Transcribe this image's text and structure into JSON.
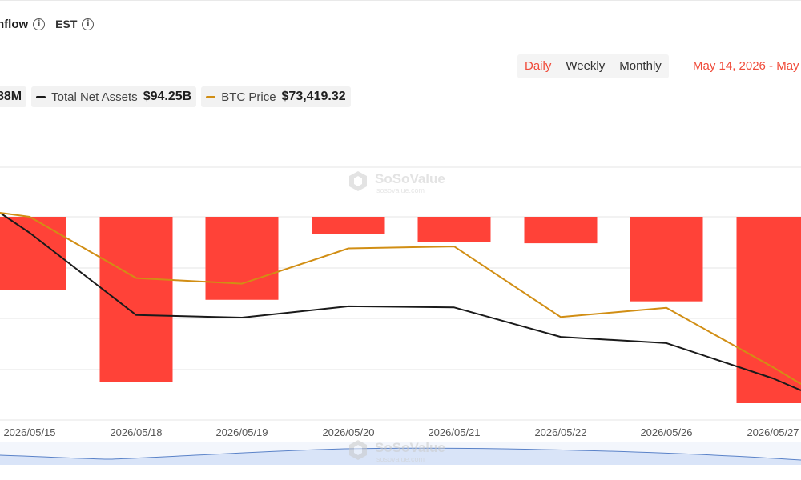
{
  "header": {
    "title": "nflow",
    "timezone": "EST"
  },
  "controls": {
    "periods": [
      {
        "label": "Daily",
        "active": true
      },
      {
        "label": "Weekly",
        "active": false
      },
      {
        "label": "Monthly",
        "active": false
      }
    ],
    "date_range": "May 14, 2026 - May"
  },
  "legend": {
    "inflow_value": "88M",
    "assets_label": "Total Net Assets",
    "assets_value": "$94.25B",
    "btc_label": "BTC Price",
    "btc_value": "$73,419.32"
  },
  "watermark": {
    "brand": "SoSoValue",
    "domain": "sosovalue.com"
  },
  "colors": {
    "inflow_bar": "#ff4238",
    "net_assets_line": "#1a1a1a",
    "btc_line": "#d18e14",
    "accent": "#f04b3a",
    "navigator_fill": "#d9e4f8",
    "navigator_line": "#5a82c8"
  },
  "chart_data": {
    "type": "bar",
    "categories": [
      "2026/05/15",
      "2026/05/18",
      "2026/05/19",
      "2026/05/20",
      "2026/05/21",
      "2026/05/22",
      "2026/05/26",
      "2026/05/27"
    ],
    "series": [
      {
        "values": [
          -144,
          -324,
          -163,
          -34,
          -49,
          -52,
          -166,
          -366
        ]
      },
      {
        "values": [
          97.05,
          94.79,
          94.72,
          95.03,
          95.0,
          94.19,
          94.02,
          93.05
        ]
      },
      {
        "values": [
          80000,
          76700,
          76400,
          78300,
          78400,
          74600,
          75100,
          71900
        ]
      }
    ],
    "grid": true
  }
}
